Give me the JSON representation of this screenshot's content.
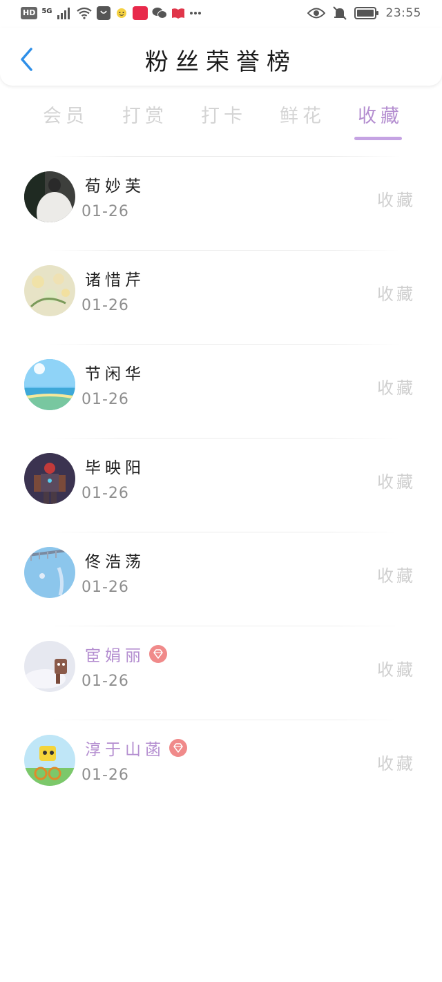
{
  "status_bar": {
    "hd_badge": "HD",
    "network": "5G",
    "time": "23:55",
    "icons": [
      "hd-icon",
      "signal-icon",
      "wifi-icon",
      "bag-app-icon",
      "smile-app-icon",
      "red-app-icon",
      "wechat-icon",
      "book-app-icon",
      "more-icon",
      "eye-icon",
      "mute-bell-icon",
      "battery-icon"
    ]
  },
  "header": {
    "title": "粉丝荣誉榜",
    "back_icon": "chevron-left-icon",
    "accent_color": "#2e8fe8"
  },
  "tabs": {
    "items": [
      {
        "label": "会员"
      },
      {
        "label": "打赏"
      },
      {
        "label": "打卡"
      },
      {
        "label": "鲜花"
      },
      {
        "label": "收藏"
      }
    ],
    "active_index": 4,
    "active_color": "#b48ed0"
  },
  "list": {
    "items": [
      {
        "name": "荀妙芙",
        "date": "01-26",
        "action": "收藏",
        "vip": false
      },
      {
        "name": "诸惜芹",
        "date": "01-26",
        "action": "收藏",
        "vip": false
      },
      {
        "name": "节闲华",
        "date": "01-26",
        "action": "收藏",
        "vip": false
      },
      {
        "name": "毕映阳",
        "date": "01-26",
        "action": "收藏",
        "vip": false
      },
      {
        "name": "佟浩荡",
        "date": "01-26",
        "action": "收藏",
        "vip": false
      },
      {
        "name": "宦娟丽",
        "date": "01-26",
        "action": "收藏",
        "vip": true
      },
      {
        "name": "淳于山菡",
        "date": "01-26",
        "action": "收藏",
        "vip": true
      }
    ]
  }
}
